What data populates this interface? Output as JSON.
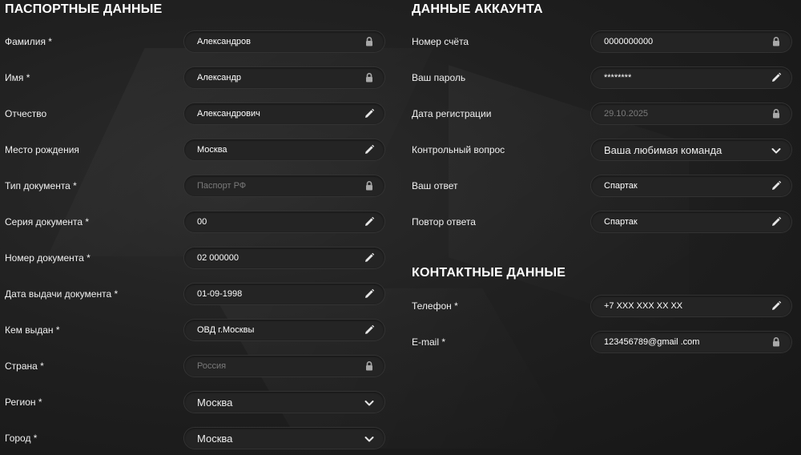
{
  "passport": {
    "title": "ПАСПОРТНЫЕ ДАННЫЕ",
    "fields": [
      {
        "label": "Фамилия *",
        "value": "Александров",
        "kind": "locked"
      },
      {
        "label": "Имя *",
        "value": "Александр",
        "kind": "locked"
      },
      {
        "label": "Отчество",
        "value": "Александрович",
        "kind": "edit"
      },
      {
        "label": "Место рождения",
        "value": "Москва",
        "kind": "edit"
      },
      {
        "label": "Тип документа *",
        "value": "Паспорт РФ",
        "kind": "disabled"
      },
      {
        "label": "Серия документа *",
        "value": "00",
        "kind": "edit"
      },
      {
        "label": "Номер документа *",
        "value": "02 000000",
        "kind": "edit"
      },
      {
        "label": "Дата выдачи документа *",
        "value": "01-09-1998",
        "kind": "edit"
      },
      {
        "label": "Кем выдан *",
        "value": "ОВД г.Москвы",
        "kind": "edit"
      },
      {
        "label": "Страна *",
        "value": "Россия",
        "kind": "disabled"
      },
      {
        "label": "Регион *",
        "value": "Москва",
        "kind": "select"
      },
      {
        "label": "Город *",
        "value": "Москва",
        "kind": "select"
      }
    ]
  },
  "account": {
    "title": "ДАННЫЕ АККАУНТА",
    "fields": [
      {
        "label": "Номер счёта",
        "value": "0000000000",
        "kind": "locked"
      },
      {
        "label": "Ваш пароль",
        "value": "********",
        "kind": "edit"
      },
      {
        "label": "Дата регистрации",
        "value": "29.10.2025",
        "kind": "disabled"
      },
      {
        "label": "Контрольный вопрос",
        "value": "Ваша любимая команда",
        "kind": "select"
      },
      {
        "label": "Ваш ответ",
        "value": "Спартак",
        "kind": "edit"
      },
      {
        "label": "Повтор ответа",
        "value": "Спартак",
        "kind": "edit"
      }
    ]
  },
  "contacts": {
    "title": "КОНТАКТНЫЕ ДАННЫЕ",
    "fields": [
      {
        "label": "Телефон *",
        "value": "+7 XXX XXX XX XX",
        "kind": "edit"
      },
      {
        "label": "E-mail *",
        "value": "123456789@gmail .com",
        "kind": "locked"
      }
    ]
  },
  "icons": {
    "locked": "lock-icon",
    "disabled": "lock-icon",
    "edit": "pencil-icon",
    "select": "chevron-down-icon"
  },
  "colors": {
    "background": "#1e1e1e",
    "field_bg": "#242424",
    "text": "#ffffff",
    "disabled_text": "#7a7a7a",
    "icon": "#bdbdbd"
  }
}
